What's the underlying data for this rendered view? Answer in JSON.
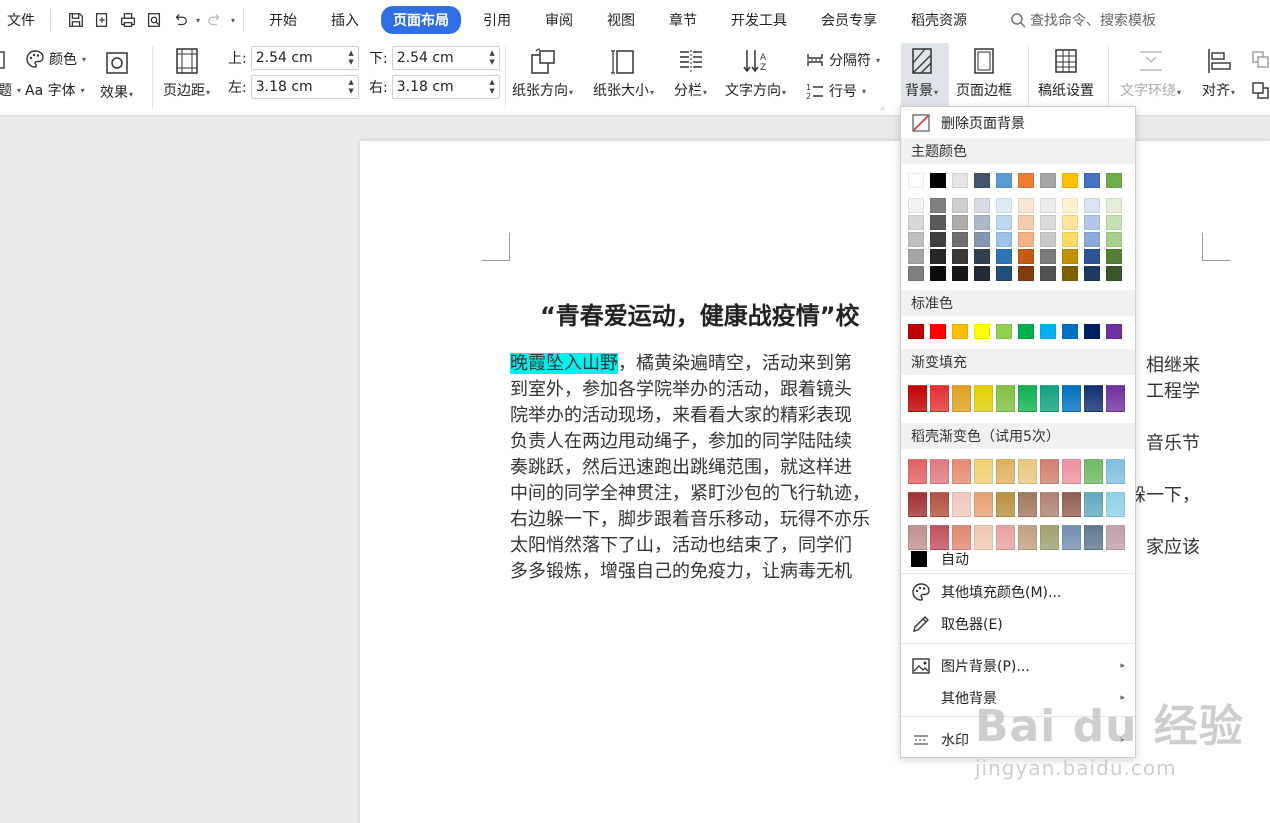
{
  "menubar": {
    "file": "文件",
    "tabs": [
      "开始",
      "插入",
      "页面布局",
      "引用",
      "审阅",
      "视图",
      "章节",
      "开发工具",
      "会员专享",
      "稻壳资源"
    ],
    "active_tab": "页面布局",
    "search_placeholder": "查找命令、搜索模板"
  },
  "ribbon": {
    "theme_partial": "题",
    "colors": "颜色",
    "font": "Aa 字体",
    "effects": "效果",
    "margins": "页边距",
    "margin_top_label": "上:",
    "margin_top_value": "2.54 cm",
    "margin_bottom_label": "下:",
    "margin_bottom_value": "2.54 cm",
    "margin_left_label": "左:",
    "margin_left_value": "3.18 cm",
    "margin_right_label": "右:",
    "margin_right_value": "3.18 cm",
    "orientation": "纸张方向",
    "size": "纸张大小",
    "columns": "分栏",
    "text_direction": "文字方向",
    "breaks": "分隔符",
    "line_numbers": "行号",
    "background": "背景",
    "page_border": "页面边框",
    "paper_settings": "稿纸设置",
    "text_wrap": "文字环绕",
    "align": "对齐"
  },
  "document": {
    "title": "“青春爱运动，健康战疫情”校",
    "highlight": "晚霞坠入山野",
    "line1_rest": "，橘黄染遍晴空，活动来到第",
    "line1_right": "相继来",
    "line2": "到室外，参加各学院举办的活动，跟着镜头",
    "line2_right": "工程学",
    "line3": "院举办的活动现场，来看看大家的精彩表现",
    "line4": "负责人在两边甩动绳子，参加的同学陆陆续",
    "line4_right": "音乐节",
    "line5": "奏跳跃，然后迅速跑出跳绳范围，就这样进",
    "line6": "中间的同学全神贯注，紧盯沙包的飞行轨迹，",
    "line6_right": "躲一下，",
    "line7": "右边躲一下，脚步跟着音乐移动，玩得不亦乐",
    "line8": "太阳悄然落下了山，活动也结束了，同学们",
    "line8_right": "家应该",
    "line9": "多多锻炼，增强自己的免疫力，让病毒无机"
  },
  "dropdown": {
    "remove_background": "删除页面背景",
    "theme_colors": "主题颜色",
    "standard_colors": "标准色",
    "gradient_fill": "渐变填充",
    "docer_gradient": "稻壳渐变色（试用5次）",
    "auto": "自动",
    "more_colors": "其他填充颜色(M)...",
    "eyedropper": "取色器(E)",
    "picture_background": "图片背景(P)...",
    "other_background": "其他背景",
    "watermark": "水印",
    "theme_row": [
      "#ffffff",
      "#000000",
      "#e7e6e6",
      "#44546a",
      "#5b9bd5",
      "#ed7d31",
      "#a5a5a5",
      "#ffc000",
      "#4472c4",
      "#70ad47"
    ],
    "theme_shades": [
      [
        "#f2f2f2",
        "#7f7f7f",
        "#d0cece",
        "#d6dce4",
        "#deebf6",
        "#fbe5d5",
        "#ededed",
        "#fff2cc",
        "#dae3f3",
        "#e2efd9"
      ],
      [
        "#d8d8d8",
        "#595959",
        "#aeabab",
        "#adb9ca",
        "#bdd7ee",
        "#f7cbac",
        "#dbdbdb",
        "#fee599",
        "#b4c6e7",
        "#c5e0b3"
      ],
      [
        "#bfbfbf",
        "#3f3f3f",
        "#757070",
        "#8496b0",
        "#9dc3e6",
        "#f4b183",
        "#c9c9c9",
        "#ffd965",
        "#8eaadb",
        "#a8d08d"
      ],
      [
        "#a5a5a5",
        "#262626",
        "#3a3838",
        "#323f4f",
        "#2e75b5",
        "#c55a11",
        "#7b7b7b",
        "#bf9000",
        "#2f5496",
        "#538135"
      ],
      [
        "#7f7f7f",
        "#0c0c0c",
        "#171616",
        "#222a35",
        "#1e4e79",
        "#833c0b",
        "#525252",
        "#7f6000",
        "#1f3864",
        "#375623"
      ]
    ],
    "standard_row": [
      "#c00000",
      "#ff0000",
      "#ffc000",
      "#ffff00",
      "#92d050",
      "#00b050",
      "#00b0f0",
      "#0070c0",
      "#002060",
      "#7030a0"
    ],
    "gradient_row": [
      "#c00000",
      "#e03030",
      "#e0a020",
      "#e0d000",
      "#80c040",
      "#10b050",
      "#10a080",
      "#0070c0",
      "#103070",
      "#7030a0"
    ],
    "docer_rows": [
      [
        "#e06060",
        "#e07880",
        "#e88a70",
        "#f0d070",
        "#e0b060",
        "#e8c880",
        "#d08070",
        "#f090a0",
        "#70b860",
        "#80c0e0"
      ],
      [
        "#a03030",
        "#b05040",
        "#f0c8c0",
        "#e8a070",
        "#b89040",
        "#a07860",
        "#b08070",
        "#906050",
        "#60a8c0",
        "#90d0e8"
      ],
      [
        "#c09090",
        "#c05060",
        "#e08870",
        "#f0c8b0",
        "#e8a0a0",
        "#c0a080",
        "#a0a070",
        "#7090b0",
        "#607890",
        "#c0a0a8"
      ]
    ]
  },
  "watermark_site": {
    "brand": "Bai du 经验",
    "url": "jingyan.baidu.com"
  }
}
